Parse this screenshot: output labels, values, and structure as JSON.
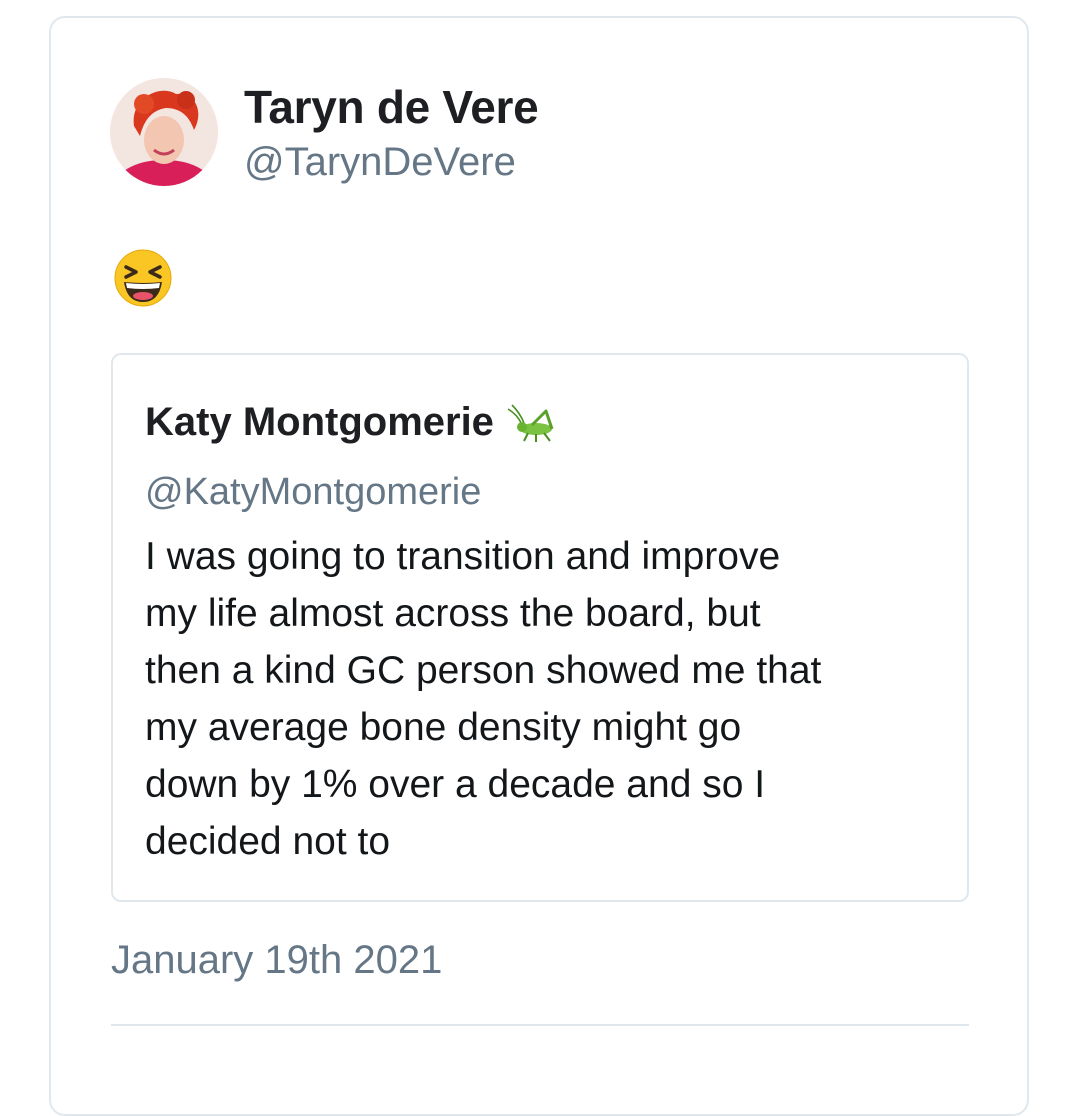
{
  "tweet": {
    "author_name": "Taryn de Vere",
    "author_handle": "@TarynDeVere",
    "avatar_icon": "profile-photo-red-hair",
    "emoji_icon": "grinning-squinting-face",
    "date": "January 19th 2021"
  },
  "quoted_tweet": {
    "author_name": "Katy Montgomerie",
    "name_emoji_icon": "cricket-icon",
    "author_handle": "@KatyMontgomerie",
    "text_lines": [
      "I was going to transition and improve",
      "my life almost across the board, but",
      "then a kind GC person showed me that",
      "my average bone density might go",
      "down by 1% over a decade and so I",
      "decided not to"
    ]
  },
  "colors": {
    "border": "#e1e8ed",
    "secondary_text": "#657786",
    "primary_text": "#14171a"
  }
}
